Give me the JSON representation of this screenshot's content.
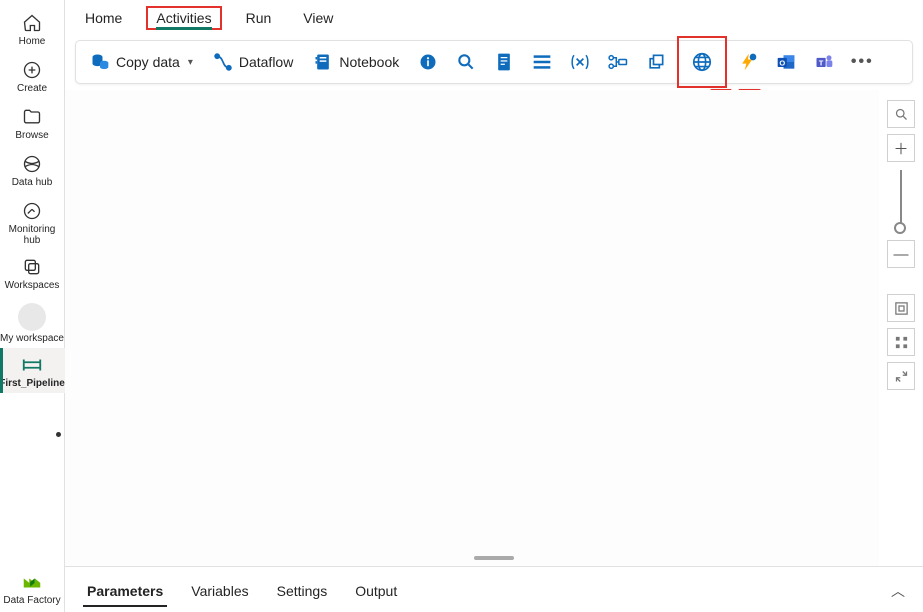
{
  "leftRail": {
    "home": "Home",
    "create": "Create",
    "browse": "Browse",
    "datahub": "Data hub",
    "monitoring": "Monitoring hub",
    "workspaces": "Workspaces",
    "myworkspace": "My workspace",
    "pipeline": "First_Pipeline",
    "datafactory": "Data Factory"
  },
  "topTabs": {
    "home": "Home",
    "activities": "Activities",
    "run": "Run",
    "view": "View"
  },
  "ribbon": {
    "copydata": "Copy data",
    "dataflow": "Dataflow",
    "notebook": "Notebook",
    "web_tooltip": "Web"
  },
  "bottom": {
    "parameters": "Parameters",
    "variables": "Variables",
    "settings": "Settings",
    "output": "Output"
  },
  "colors": {
    "accent": "#0f6cbd",
    "teal_underline": "#117865",
    "highlight_red": "#e3322b"
  }
}
